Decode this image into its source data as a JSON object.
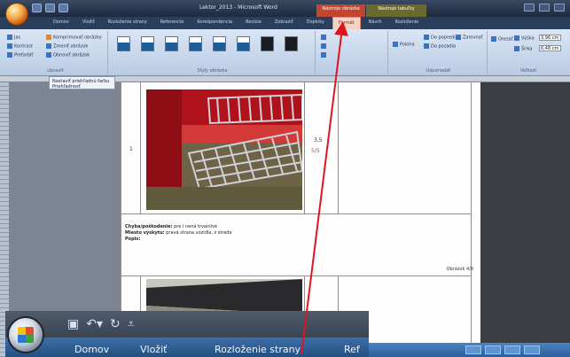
{
  "window": {
    "title": "Lektor_2013 - Microsoft Word"
  },
  "context_groups": [
    "Nástroje obrázka",
    "Nástroje tabuľky"
  ],
  "tabs": [
    "Domov",
    "Vložiť",
    "Rozloženie strany",
    "Referencie",
    "Korešpondencia",
    "Revízia",
    "Zobraziť",
    "Doplnky",
    "Formát",
    "Návrh",
    "Rozloženie"
  ],
  "active_tab_index": 8,
  "ribbon": {
    "groups": [
      "Upraviť",
      "Štýly obrázka",
      "Usporiadať",
      "Veľkosť"
    ],
    "adjust": [
      "Jas",
      "Kontrast",
      "Prefarbiť",
      "Komprimovať obrázky",
      "Zmeniť obrázok",
      "Obnoviť obrázok"
    ],
    "arrange": [
      "Poloha",
      "Do popredia",
      "Do pozadia",
      "Zarovnať"
    ],
    "size": {
      "height_label": "Výška",
      "height_value": "3,96 cm",
      "width_label": "Šírka",
      "width_value": "6,48 cm",
      "crop_label": "Orezať"
    }
  },
  "dropdown": {
    "items": [
      "Nastaviť priehľadnú farbu",
      "Priehľadnosť"
    ]
  },
  "document": {
    "row_number": "1",
    "value_a": "3,5",
    "value_b": "5/5",
    "findings": [
      {
        "label": "Chyba/poškodenie:",
        "text": "pre I nená trvanlivé"
      },
      {
        "label": "Miesto výskytu:",
        "text": "pravá strana vozidla, z strede"
      },
      {
        "label": "Popis:",
        "text": ""
      }
    ],
    "photo_label": "Obrázok 4/9"
  },
  "zoom": {
    "tabs": [
      "Domov",
      "Vložiť",
      "Rozloženie strany",
      "Ref"
    ]
  },
  "colors": {
    "accent_tab": "#f2d3c6",
    "arrow": "#e0141d",
    "context_a": "#c4452f",
    "context_b": "#6b6a2e"
  }
}
